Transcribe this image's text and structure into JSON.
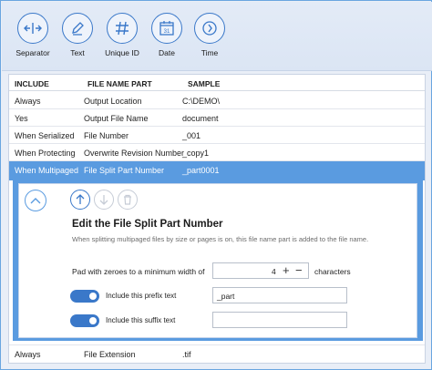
{
  "toolbar": {
    "items": [
      {
        "label": "Separator",
        "icon": "separator-icon"
      },
      {
        "label": "Text",
        "icon": "pencil-icon"
      },
      {
        "label": "Unique ID",
        "icon": "hash-icon"
      },
      {
        "label": "Date",
        "icon": "calendar-icon"
      },
      {
        "label": "Time",
        "icon": "chevron-right-icon"
      }
    ],
    "date_icon_text": "31"
  },
  "table": {
    "headers": [
      "INCLUDE",
      "FILE NAME PART",
      "SAMPLE"
    ],
    "rows": [
      {
        "include": "Always",
        "part": "Output Location",
        "sample": "C:\\DEMO\\"
      },
      {
        "include": "Yes",
        "part": "Output File Name",
        "sample": "document"
      },
      {
        "include": "When Serialized",
        "part": "File Number",
        "sample": "_001"
      },
      {
        "include": "When Protecting",
        "part": "Overwrite Revision Number",
        "sample": "_copy1"
      },
      {
        "include": "When Multipaged",
        "part": "File Split Part Number",
        "sample": "_part0001"
      }
    ],
    "last_row": {
      "include": "Always",
      "part": "File Extension",
      "sample": ".tif"
    }
  },
  "editor": {
    "title": "Edit the File Split Part Number",
    "description": "When splitting multipaged files by size or pages is on, this file name part is added to the file name.",
    "pad_label": "Pad with zeroes to a minimum width of",
    "pad_value": "4",
    "pad_unit": "characters",
    "prefix_label": "Include this prefix text",
    "prefix_value": "_part",
    "prefix_enabled": true,
    "suffix_label": "Include this suffix text",
    "suffix_value": "",
    "suffix_enabled": true
  },
  "colors": {
    "accent": "#3a78c9",
    "selection": "#5a9be0"
  }
}
